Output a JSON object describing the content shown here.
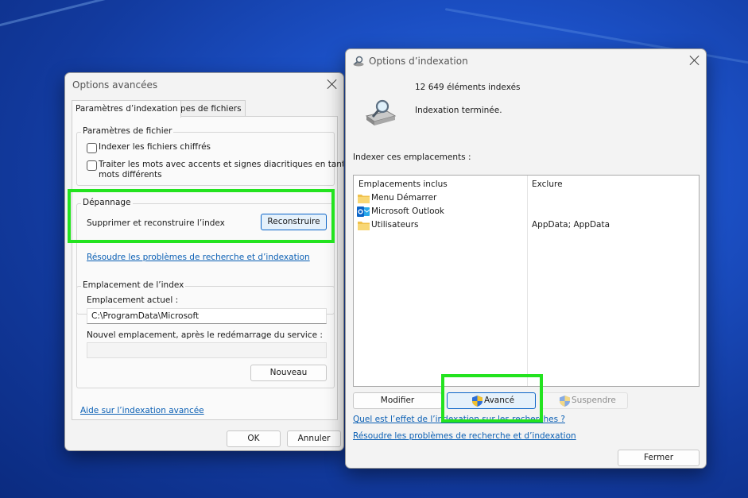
{
  "advanced": {
    "title": "Options avancées",
    "tabs": [
      {
        "label": "Paramètres d’indexation"
      },
      {
        "label": "Types de fichiers"
      }
    ],
    "file_settings": {
      "label": "Paramètres de fichier",
      "checkbox1": "Indexer les fichiers chiffrés",
      "checkbox2_line1": "Traiter les mots avec accents et signes diacritiques en tant que",
      "checkbox2_line2": "mots différents"
    },
    "troubleshoot": {
      "label": "Dépannage",
      "text": "Supprimer et reconstruire l’index",
      "button": "Reconstruire",
      "link": "Résoudre les problèmes de recherche et d’indexation"
    },
    "index_location": {
      "label": "Emplacement de l’index",
      "current_label": "Emplacement actuel :",
      "current_value": "C:\\ProgramData\\Microsoft",
      "new_label": "Nouvel emplacement, après le redémarrage du service :",
      "new_value": "",
      "new_button": "Nouveau"
    },
    "help_link": "Aide sur l’indexation avancée",
    "ok": "OK",
    "cancel": "Annuler"
  },
  "indexing": {
    "title": "Options d’indexation",
    "count": "12 649 éléments indexés",
    "status": "Indexation terminée.",
    "locations_label": "Indexer ces emplacements :",
    "col_included": "Emplacements inclus",
    "col_exclude": "Exclure",
    "rows": [
      {
        "name": "Menu Démarrer",
        "icon": "folder-icon",
        "exclude": ""
      },
      {
        "name": "Microsoft Outlook",
        "icon": "outlook-icon",
        "exclude": ""
      },
      {
        "name": "Utilisateurs",
        "icon": "folder-icon",
        "exclude": "AppData; AppData"
      }
    ],
    "modify": "Modifier",
    "advanced": "Avancé",
    "pause": "Suspendre",
    "link1": "Quel est l’effet de l’indexation sur les recherches ?",
    "link2": "Résoudre les problèmes de recherche et d’indexation",
    "close": "Fermer"
  },
  "colors": {
    "highlight": "#23e31f",
    "link": "#0a5fb4",
    "accent_border": "#0a64c8"
  }
}
